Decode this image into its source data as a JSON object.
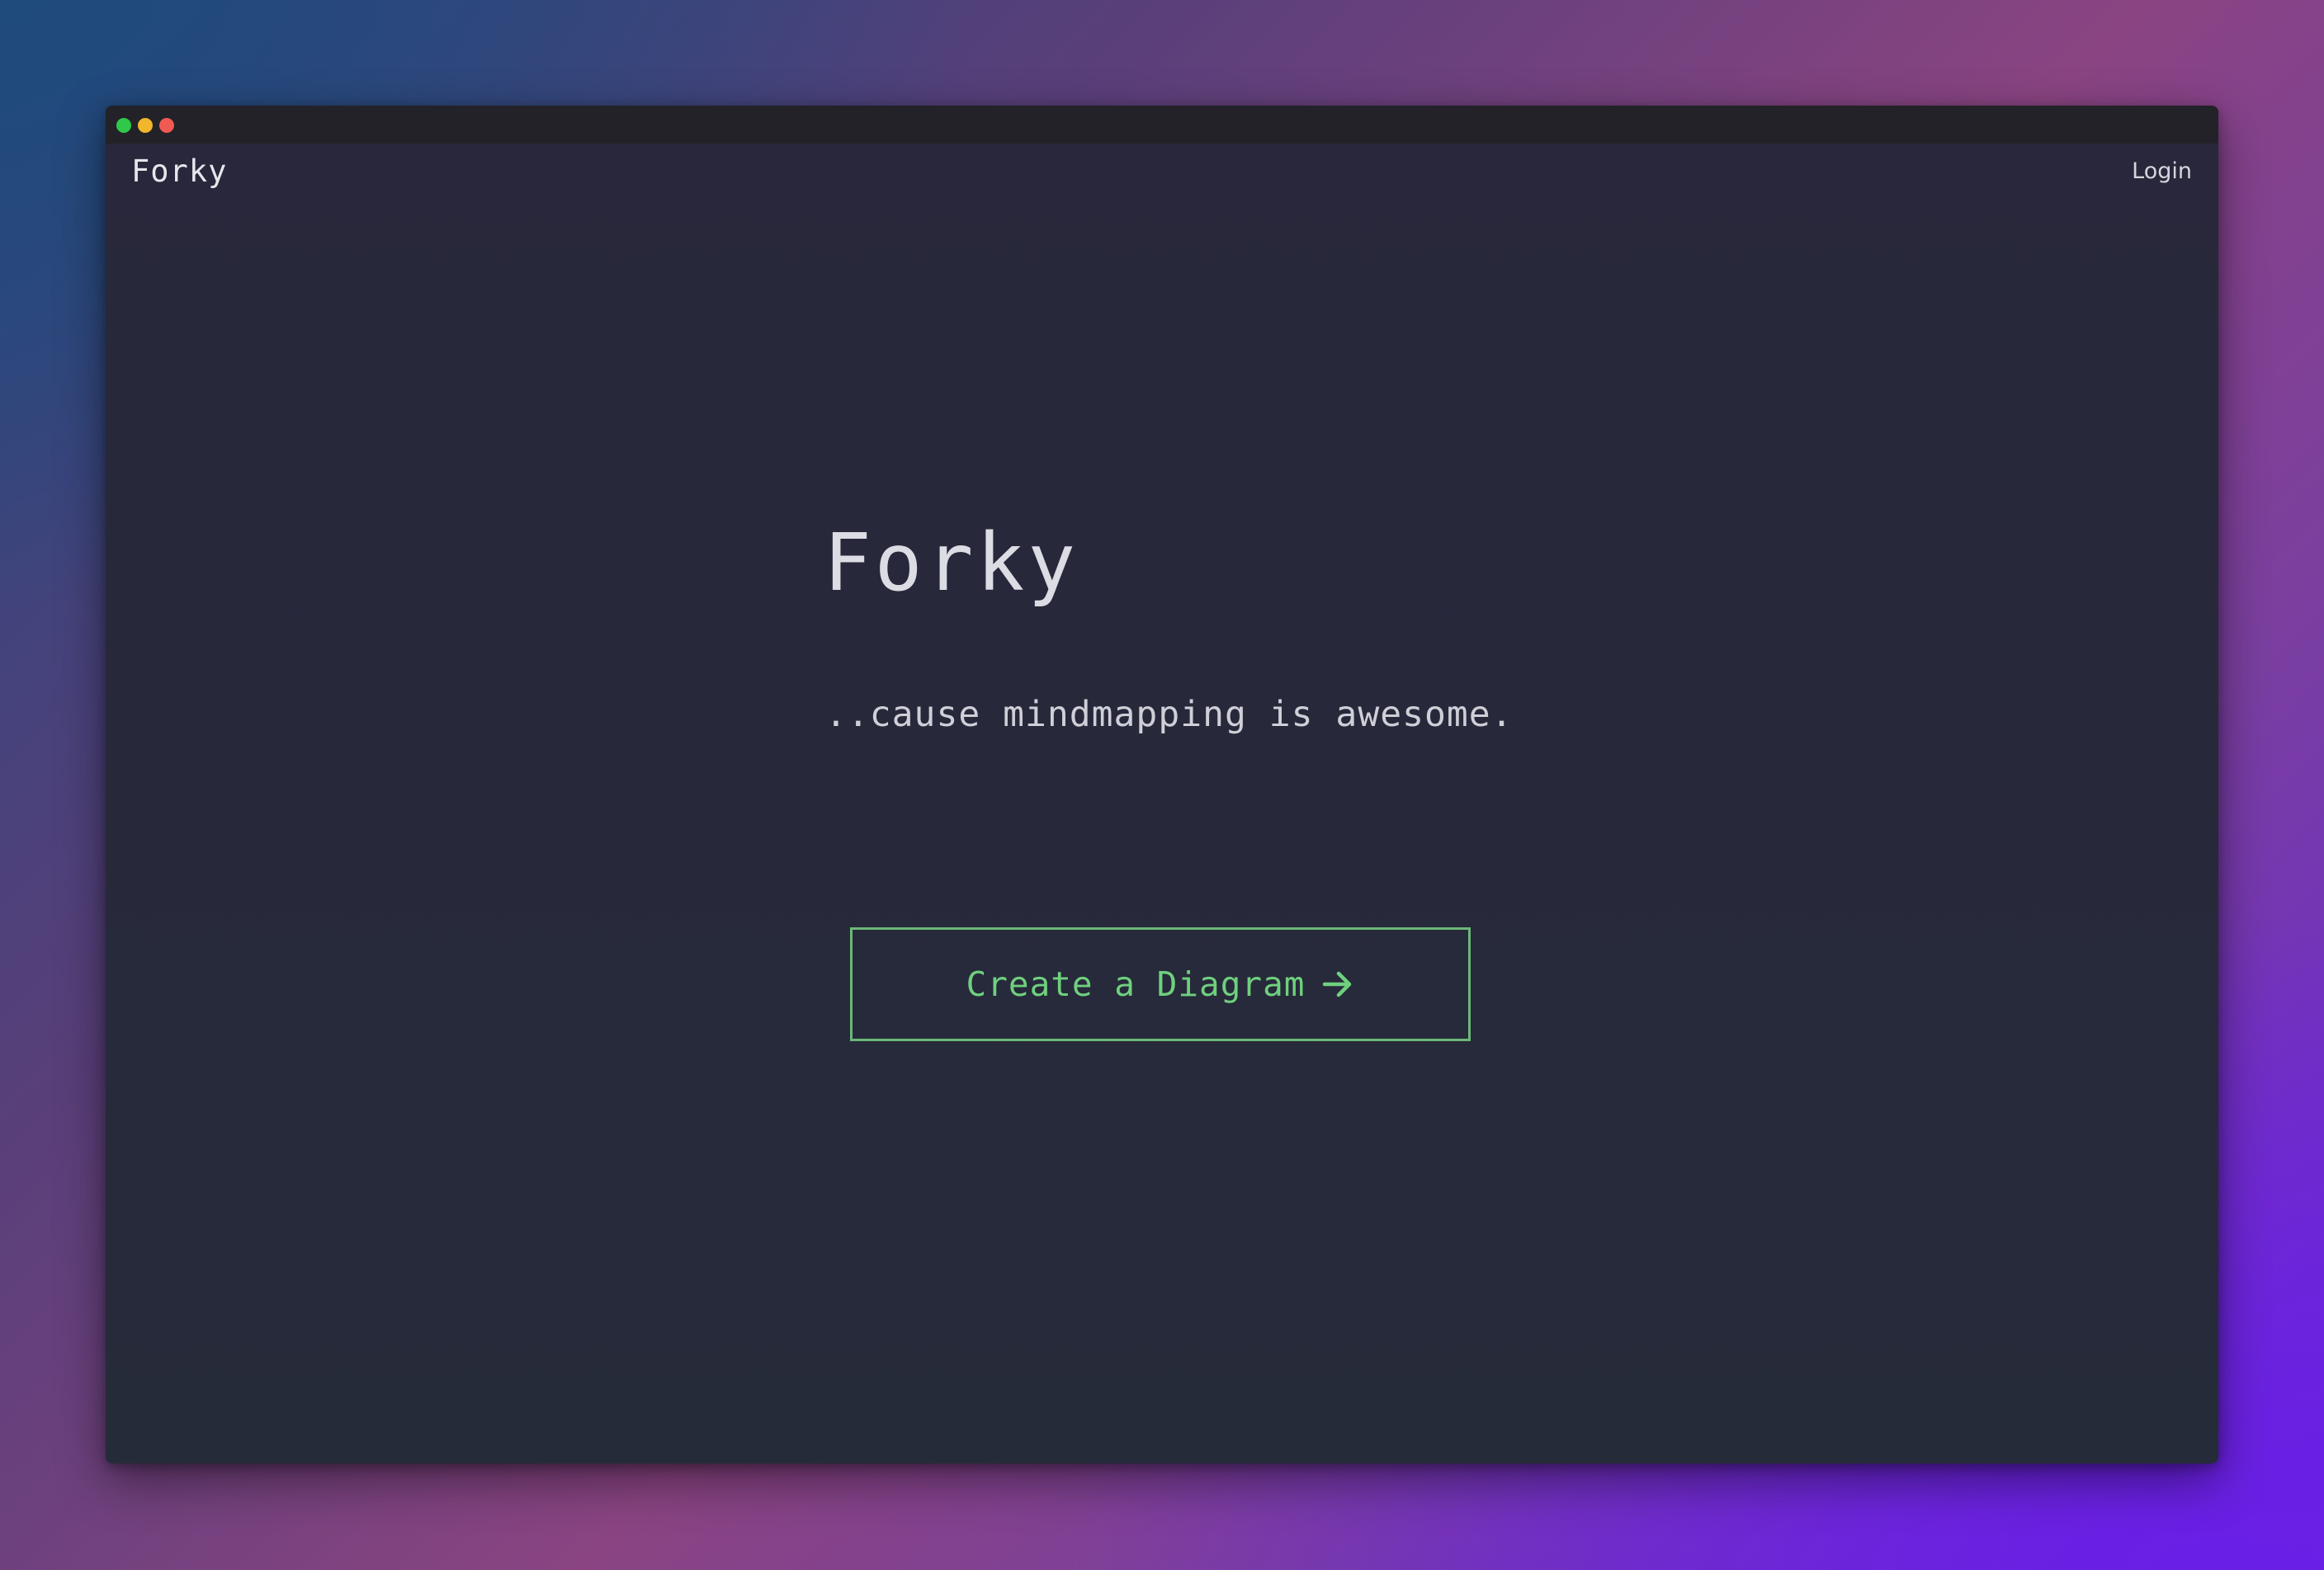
{
  "colors": {
    "background_start": "#27487e",
    "background_end": "#6a22e0",
    "window_bg": "#28273b",
    "titlebar_bg": "#222228",
    "accent_green": "#6fd07e",
    "button_border": "#6cb878",
    "dot_green": "#30c84a",
    "dot_yellow": "#f2b62c",
    "dot_red": "#f05a52"
  },
  "window": {
    "controls": [
      {
        "name": "green-dot",
        "color": "#30c84a"
      },
      {
        "name": "yellow-dot",
        "color": "#f2b62c"
      },
      {
        "name": "red-dot",
        "color": "#f05a52"
      }
    ]
  },
  "navbar": {
    "brand": "Forky",
    "login_label": "Login"
  },
  "hero": {
    "title": "Forky",
    "subtitle": "..cause mindmapping is awesome.",
    "cta_label": "Create a Diagram",
    "cta_icon": "arrow-right-icon"
  }
}
